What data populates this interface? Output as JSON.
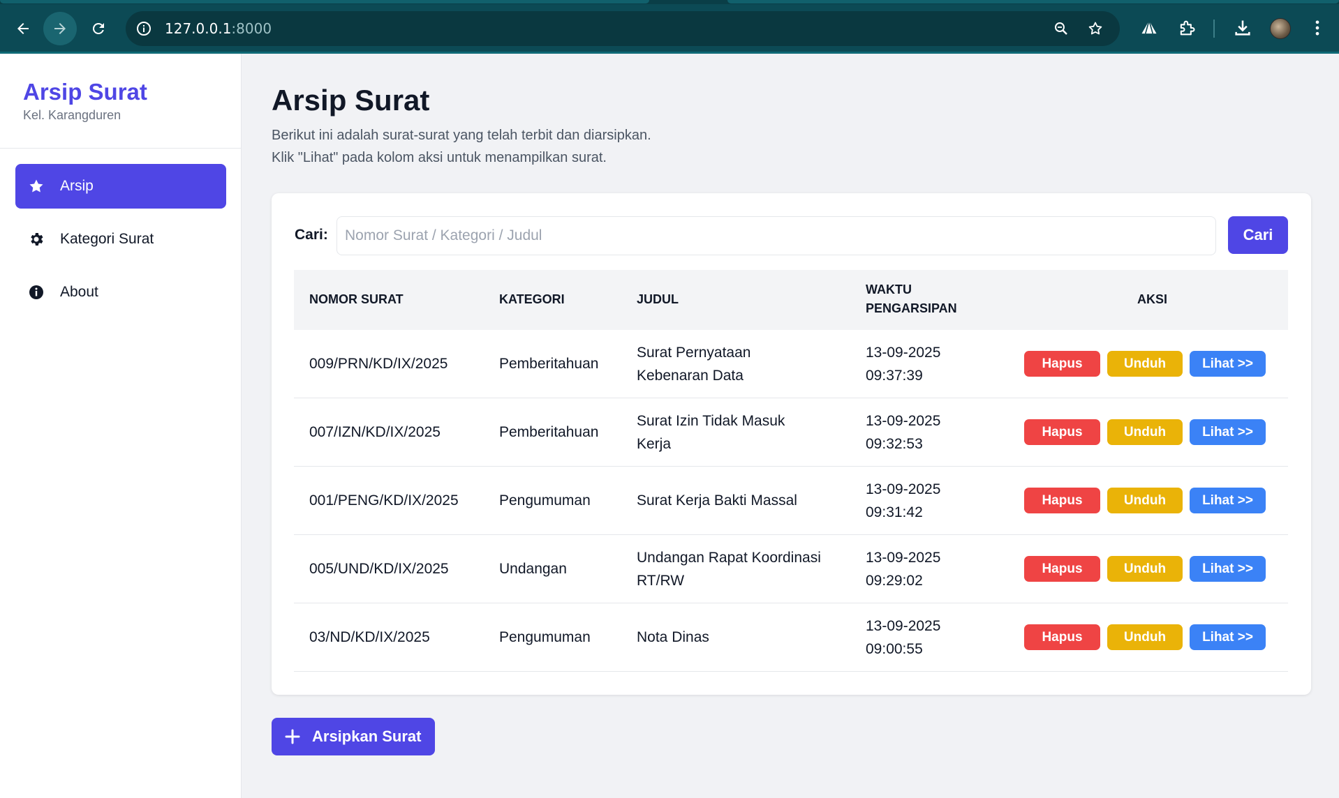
{
  "browser": {
    "url_host": "127.0.0.1",
    "url_port": ":8000"
  },
  "sidebar": {
    "brand_title": "Arsip Surat",
    "brand_subtitle": "Kel. Karangduren",
    "items": [
      {
        "label": "Arsip",
        "icon": "star-icon",
        "active": true
      },
      {
        "label": "Kategori Surat",
        "icon": "gear-icon",
        "active": false
      },
      {
        "label": "About",
        "icon": "info-icon",
        "active": false
      }
    ]
  },
  "main": {
    "title": "Arsip Surat",
    "description_line1": "Berikut ini adalah surat-surat yang telah terbit dan diarsipkan.",
    "description_line2": "Klik \"Lihat\" pada kolom aksi untuk menampilkan surat.",
    "search": {
      "label": "Cari:",
      "placeholder": "Nomor Surat / Kategori / Judul",
      "value": "",
      "button_label": "Cari"
    },
    "table": {
      "headers": {
        "nomor": "NOMOR SURAT",
        "kategori": "KATEGORI",
        "judul": "JUDUL",
        "waktu_line1": "WAKTU",
        "waktu_line2": "PENGARSIPAN",
        "aksi": "AKSI"
      },
      "rows": [
        {
          "nomor": "009/PRN/KD/IX/2025",
          "kategori": "Pemberitahuan",
          "judul_line1": "Surat Pernyataan",
          "judul_line2": "Kebenaran Data",
          "tanggal": "13-09-2025",
          "jam": "09:37:39"
        },
        {
          "nomor": "007/IZN/KD/IX/2025",
          "kategori": "Pemberitahuan",
          "judul_line1": "Surat Izin Tidak Masuk",
          "judul_line2": "Kerja",
          "tanggal": "13-09-2025",
          "jam": "09:32:53"
        },
        {
          "nomor": "001/PENG/KD/IX/2025",
          "kategori": "Pengumuman",
          "judul_line1": "Surat Kerja Bakti Massal",
          "judul_line2": "",
          "tanggal": "13-09-2025",
          "jam": "09:31:42"
        },
        {
          "nomor": "005/UND/KD/IX/2025",
          "kategori": "Undangan",
          "judul_line1": "Undangan Rapat Koordinasi",
          "judul_line2": "RT/RW",
          "tanggal": "13-09-2025",
          "jam": "09:29:02"
        },
        {
          "nomor": "03/ND/KD/IX/2025",
          "kategori": "Pengumuman",
          "judul_line1": "Nota Dinas",
          "judul_line2": "",
          "tanggal": "13-09-2025",
          "jam": "09:00:55"
        }
      ],
      "actions": {
        "hapus": "Hapus",
        "unduh": "Unduh",
        "lihat": "Lihat >>"
      }
    },
    "add_button_label": "Arsipkan Surat"
  },
  "colors": {
    "primary": "#4f46e5",
    "danger": "#ef4444",
    "warning": "#eab308",
    "info": "#3b82f6",
    "chrome": "#0c4a55"
  }
}
